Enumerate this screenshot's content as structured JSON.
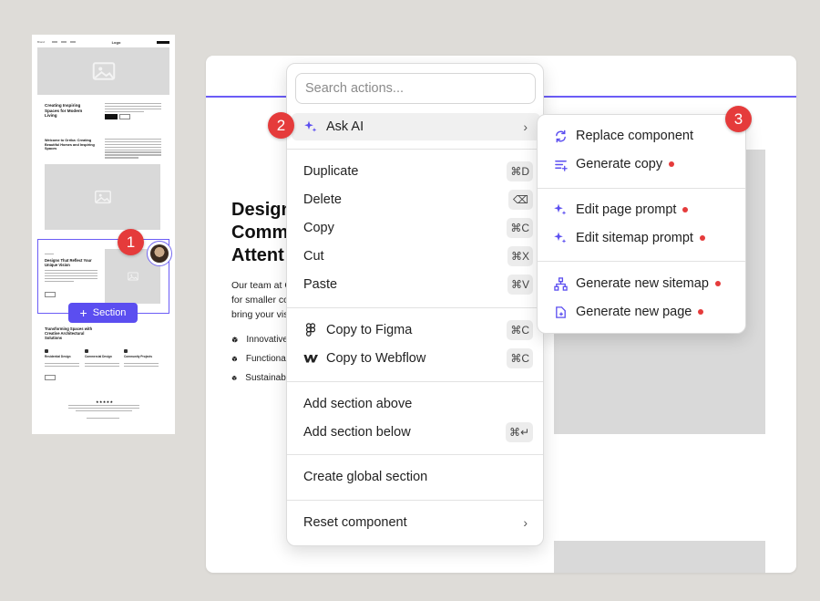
{
  "thumbnail": {
    "brand": "Brand",
    "logo": "Logo",
    "blocks": [
      {
        "title": "Creating Inspiring Spaces for Modern Living"
      },
      {
        "title": "Welcome to Orrika: Creating Beautiful Homes and Inspiring Spaces"
      },
      {
        "title": "Designs That Reflect Your Unique Vision"
      },
      {
        "title": "Transforming Spaces with Creative Architectural Solutions"
      }
    ],
    "features": [
      "Residential Design",
      "Commercial Design",
      "Community Projects"
    ],
    "stars": "★★★★★",
    "section_button": "Section"
  },
  "badges": {
    "one": "1",
    "two": "2",
    "three": "3"
  },
  "canvas": {
    "heading": "Design\nComm\nAttent",
    "paragraph": "Our team at G\nfor smaller cor\nbring your visi",
    "features": [
      "Innovative",
      "Functional",
      "Sustainabl"
    ]
  },
  "menu": {
    "search_placeholder": "Search actions...",
    "ask_ai": "Ask AI",
    "duplicate": {
      "label": "Duplicate",
      "kbd": "⌘D"
    },
    "delete": {
      "label": "Delete",
      "kbd": "⌫"
    },
    "copy": {
      "label": "Copy",
      "kbd": "⌘C"
    },
    "cut": {
      "label": "Cut",
      "kbd": "⌘X"
    },
    "paste": {
      "label": "Paste",
      "kbd": "⌘V"
    },
    "copy_figma": {
      "label": "Copy to Figma",
      "kbd": "⌘C"
    },
    "copy_webflow": {
      "label": "Copy to Webflow",
      "kbd": "⌘C"
    },
    "add_above": {
      "label": "Add section above"
    },
    "add_below": {
      "label": "Add section below",
      "kbd": "⌘↵"
    },
    "global_section": {
      "label": "Create global section"
    },
    "reset": {
      "label": "Reset component"
    }
  },
  "submenu": {
    "replace": "Replace component",
    "generate_copy": "Generate copy",
    "edit_page_prompt": "Edit page prompt",
    "edit_sitemap_prompt": "Edit sitemap prompt",
    "generate_sitemap": "Generate new sitemap",
    "generate_page": "Generate new page"
  },
  "colors": {
    "accent": "#5b4ef0",
    "badge": "#e53b3b",
    "placeholder": "#d9d9d9"
  }
}
